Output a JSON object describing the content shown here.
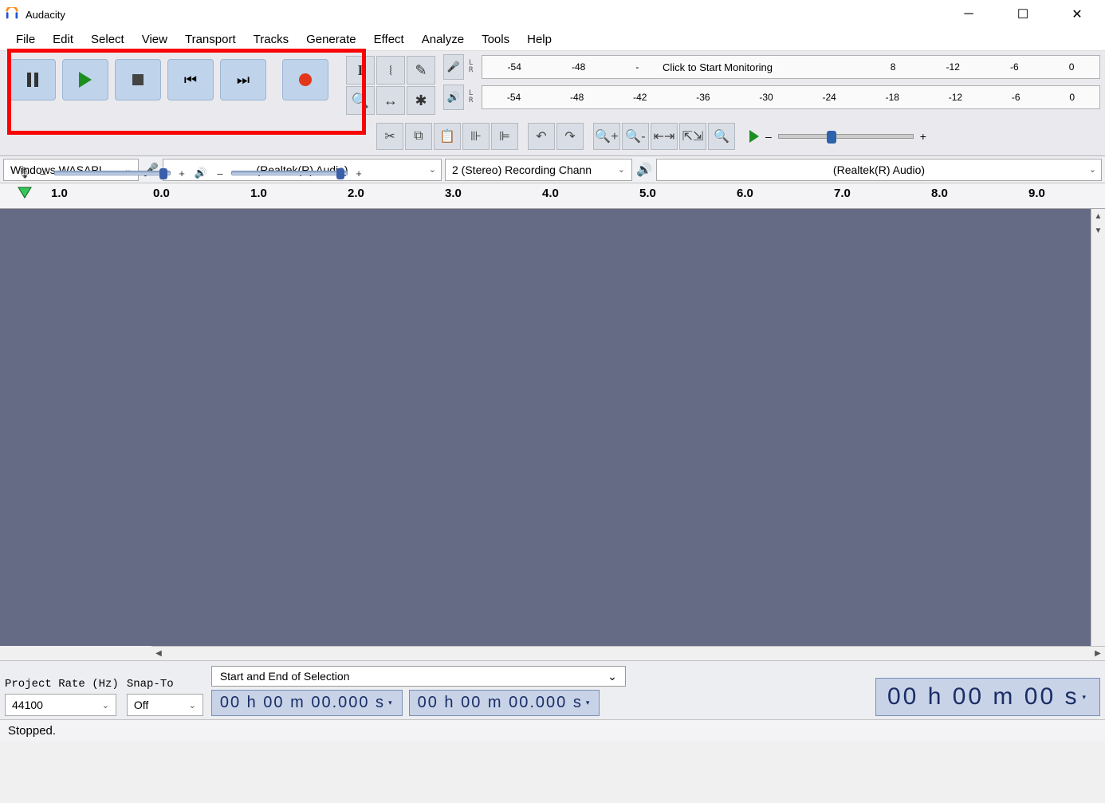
{
  "window": {
    "title": "Audacity"
  },
  "menu": {
    "items": [
      "File",
      "Edit",
      "Select",
      "View",
      "Transport",
      "Tracks",
      "Generate",
      "Effect",
      "Analyze",
      "Tools",
      "Help"
    ]
  },
  "meters": {
    "record_scale": [
      "-54",
      "-48",
      "-",
      "",
      "",
      "",
      "",
      "8",
      "-12",
      "-6",
      "0"
    ],
    "record_click_text": "Click to Start Monitoring",
    "play_scale": [
      "-54",
      "-48",
      "-42",
      "-36",
      "-30",
      "-24",
      "-18",
      "-12",
      "-6",
      "0"
    ]
  },
  "devices": {
    "host": "Windows WASAPI",
    "rec_device": "(Realtek(R) Audio)",
    "rec_channels": "2 (Stereo) Recording Chann",
    "play_device": "(Realtek(R) Audio)"
  },
  "ruler": {
    "marks": [
      "1.0",
      "0.0",
      "1.0",
      "2.0",
      "3.0",
      "4.0",
      "5.0",
      "6.0",
      "7.0",
      "8.0",
      "9.0"
    ]
  },
  "bottom": {
    "project_rate_label": "Project Rate (Hz)",
    "project_rate_value": "44100",
    "snap_label": "Snap-To",
    "snap_value": "Off",
    "selection_mode": "Start and End of Selection",
    "sel_start": "00 h 00 m 00.000 s",
    "sel_end": "00 h 00 m 00.000 s",
    "position": "00 h 00 m 00 s"
  },
  "status": {
    "text": "Stopped."
  },
  "sliders": {
    "minus": "–",
    "plus": "+"
  }
}
